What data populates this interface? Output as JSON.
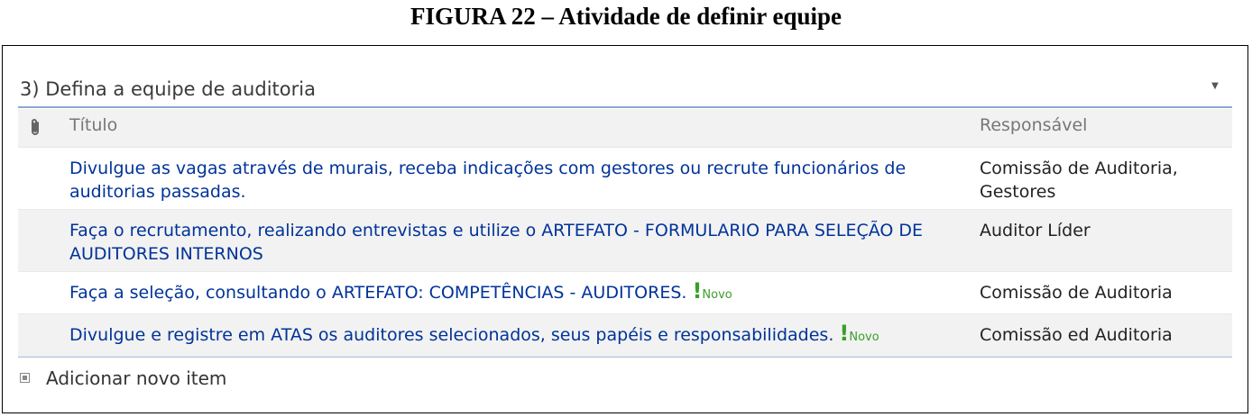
{
  "figure_caption": "FIGURA 22 – Atividade de definir equipe",
  "webpart": {
    "title": "3) Defina a equipe de auditoria",
    "menu_icon": "dropdown-arrow-icon"
  },
  "table": {
    "columns": {
      "attachment_icon": "paperclip-icon",
      "title": "Título",
      "responsible": "Responsável"
    },
    "rows": [
      {
        "title": "Divulgue as vagas através de murais, receba indicações com gestores ou recrute funcionários de auditorias passadas.",
        "responsible": "Comissão de Auditoria, Gestores",
        "is_new": false
      },
      {
        "title": "Faça o recrutamento, realizando entrevistas e utilize o ARTEFATO - FORMULARIO PARA SELEÇÃO DE AUDITORES INTERNOS",
        "responsible": "Auditor Líder",
        "is_new": false
      },
      {
        "title": "Faça a seleção, consultando o ARTEFATO: COMPETÊNCIAS - AUDITORES.",
        "responsible": "Comissão de Auditoria",
        "is_new": true,
        "new_mark": "!",
        "new_label": "Novo"
      },
      {
        "title": "Divulgue e registre em ATAS os auditores selecionados, seus papéis e responsabilidades.",
        "responsible": "Comissão ed Auditoria",
        "is_new": true,
        "new_mark": "!",
        "new_label": "Novo"
      }
    ]
  },
  "footer": {
    "add_item_label": "Adicionar novo item",
    "add_icon": "add-square-icon"
  },
  "colors": {
    "link": "#003399",
    "new_badge": "#3a9f2a",
    "title_rule": "#8aa9d2",
    "alt_row": "#f2f2f2"
  }
}
